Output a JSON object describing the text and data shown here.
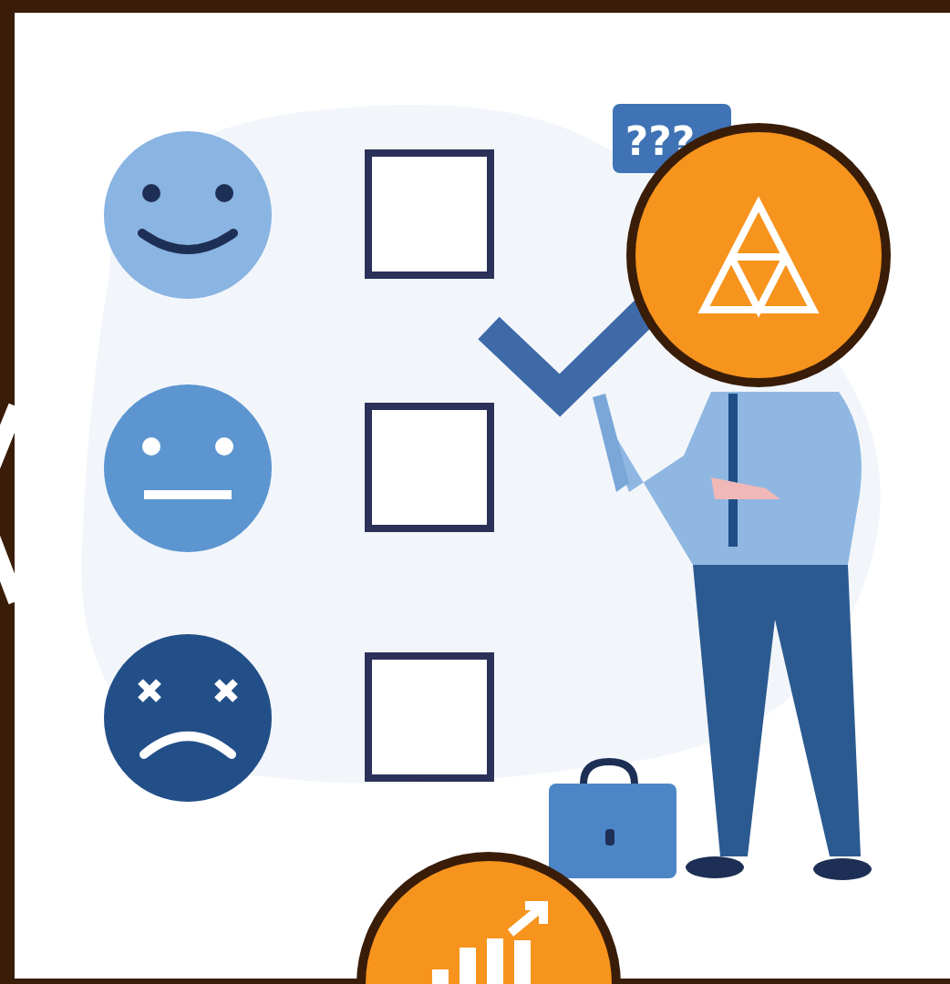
{
  "speech_bubble": {
    "text": "???"
  },
  "rows": [
    {
      "kind": "happy",
      "checked": false
    },
    {
      "kind": "neutral",
      "checked": false
    },
    {
      "kind": "sad",
      "checked": false
    }
  ]
}
